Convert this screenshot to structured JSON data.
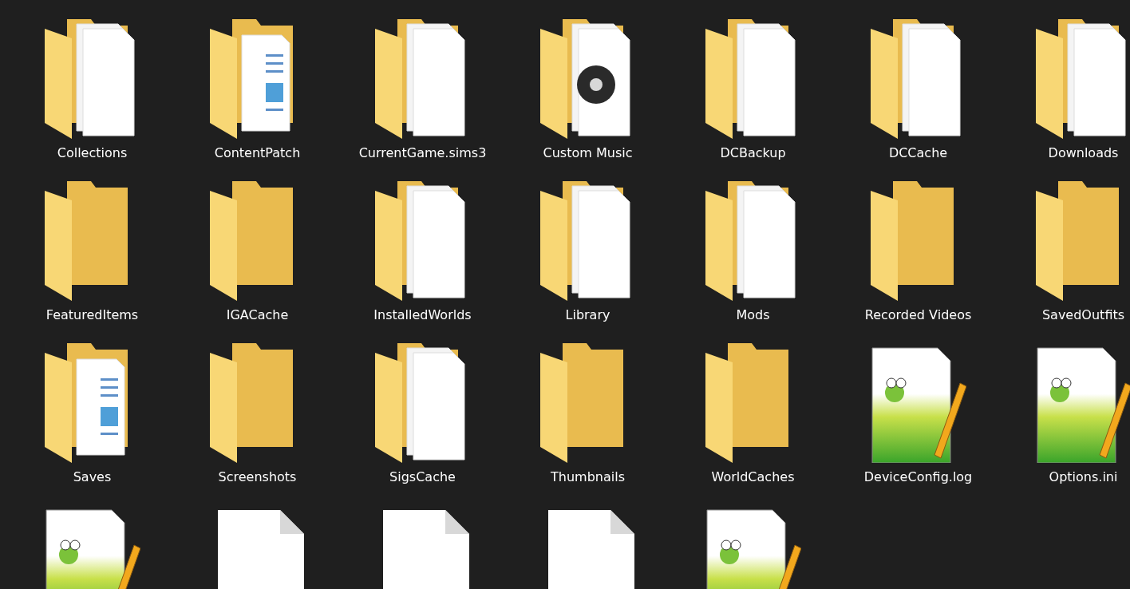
{
  "items": [
    {
      "label": "Collections",
      "kind": "folder-docs"
    },
    {
      "label": "ContentPatch",
      "kind": "folder-pictures"
    },
    {
      "label": "CurrentGame.sims3",
      "kind": "folder-docs"
    },
    {
      "label": "Custom Music",
      "kind": "folder-music"
    },
    {
      "label": "DCBackup",
      "kind": "folder-docs"
    },
    {
      "label": "DCCache",
      "kind": "folder-docs"
    },
    {
      "label": "Downloads",
      "kind": "folder-docs"
    },
    {
      "label": "FeaturedItems",
      "kind": "folder"
    },
    {
      "label": "IGACache",
      "kind": "folder"
    },
    {
      "label": "InstalledWorlds",
      "kind": "folder-docs"
    },
    {
      "label": "Library",
      "kind": "folder-docs"
    },
    {
      "label": "Mods",
      "kind": "folder-docs"
    },
    {
      "label": "Recorded Videos",
      "kind": "folder"
    },
    {
      "label": "SavedOutfits",
      "kind": "folder"
    },
    {
      "label": "Saves",
      "kind": "folder-pictures"
    },
    {
      "label": "Screenshots",
      "kind": "folder"
    },
    {
      "label": "SigsCache",
      "kind": "folder-docs"
    },
    {
      "label": "Thumbnails",
      "kind": "folder"
    },
    {
      "label": "WorldCaches",
      "kind": "folder"
    },
    {
      "label": "DeviceConfig.log",
      "kind": "notepad"
    },
    {
      "label": "Options.ini",
      "kind": "notepad"
    },
    {
      "kind": "notepad"
    },
    {
      "kind": "file"
    },
    {
      "kind": "file"
    },
    {
      "kind": "file"
    },
    {
      "kind": "notepad"
    }
  ]
}
